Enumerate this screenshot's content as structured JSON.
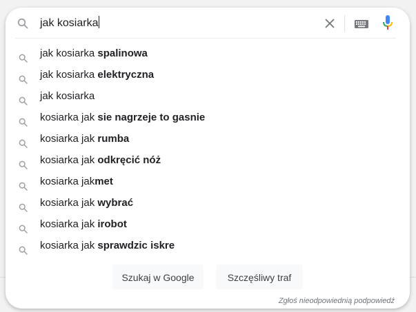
{
  "search": {
    "query": "jak kosiarka",
    "icon": "search-icon",
    "clear_icon": "close-icon",
    "keyboard_icon": "keyboard-icon",
    "mic_icon": "microphone-icon"
  },
  "suggestions": [
    {
      "prefix": "jak kosiarka ",
      "bold": "spalinowa"
    },
    {
      "prefix": "jak kosiarka ",
      "bold": "elektryczna"
    },
    {
      "prefix": "jak kosiarka",
      "bold": ""
    },
    {
      "prefix": "kosiarka jak ",
      "bold": "sie nagrzeje to gasnie"
    },
    {
      "prefix": "kosiarka jak ",
      "bold": "rumba"
    },
    {
      "prefix": "kosiarka jak ",
      "bold": "odkręcić nóż"
    },
    {
      "prefix": "kosiarka jak",
      "bold": "met"
    },
    {
      "prefix": "kosiarka jak ",
      "bold": "wybrać"
    },
    {
      "prefix": "kosiarka jak ",
      "bold": "irobot"
    },
    {
      "prefix": "kosiarka jak ",
      "bold": "sprawdzic iskre"
    }
  ],
  "buttons": {
    "search_label": "Szukaj w Google",
    "lucky_label": "Szczęśliwy traf"
  },
  "report_link": "Zgłoś nieodpowiednią podpowiedź",
  "colors": {
    "text": "#202124",
    "icon_gray": "#9aa0a6",
    "button_bg": "#f8f9fa",
    "mic_blue": "#4285f4",
    "mic_red": "#ea4335",
    "mic_yellow": "#fbbc04",
    "mic_green": "#34a853"
  }
}
